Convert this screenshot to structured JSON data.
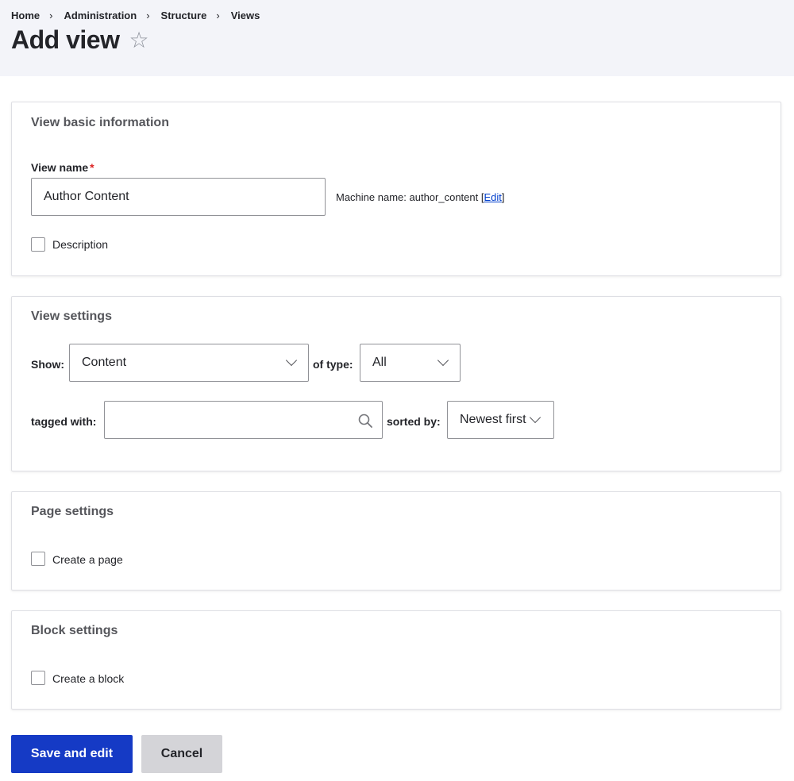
{
  "breadcrumb": [
    {
      "label": "Home"
    },
    {
      "label": "Administration"
    },
    {
      "label": "Structure"
    },
    {
      "label": "Views"
    }
  ],
  "page_title": "Add view",
  "favorite_icon": "star-outline-icon",
  "sections": {
    "basic": {
      "title": "View basic information",
      "view_name_label": "View name",
      "required_marker": "*",
      "view_name_value": "Author Content",
      "machine_name_prefix": "Machine name: author_content [",
      "machine_name_edit": "Edit",
      "machine_name_suffix": "]",
      "description_label": "Description",
      "description_checked": false
    },
    "view_settings": {
      "title": "View settings",
      "show_label": "Show:",
      "show_value": "Content",
      "of_type_label": "of type:",
      "of_type_value": "All",
      "tagged_with_label": "tagged with:",
      "tagged_with_value": "",
      "sorted_by_label": "sorted by:",
      "sorted_by_value": "Newest first"
    },
    "page_settings": {
      "title": "Page settings",
      "create_page_label": "Create a page",
      "create_page_checked": false
    },
    "block_settings": {
      "title": "Block settings",
      "create_block_label": "Create a block",
      "create_block_checked": false
    }
  },
  "actions": {
    "save_label": "Save and edit",
    "cancel_label": "Cancel"
  },
  "colors": {
    "primary": "#153ac5",
    "link": "#003ecc",
    "required": "#dc2323",
    "header_bg": "#f3f4f9"
  }
}
